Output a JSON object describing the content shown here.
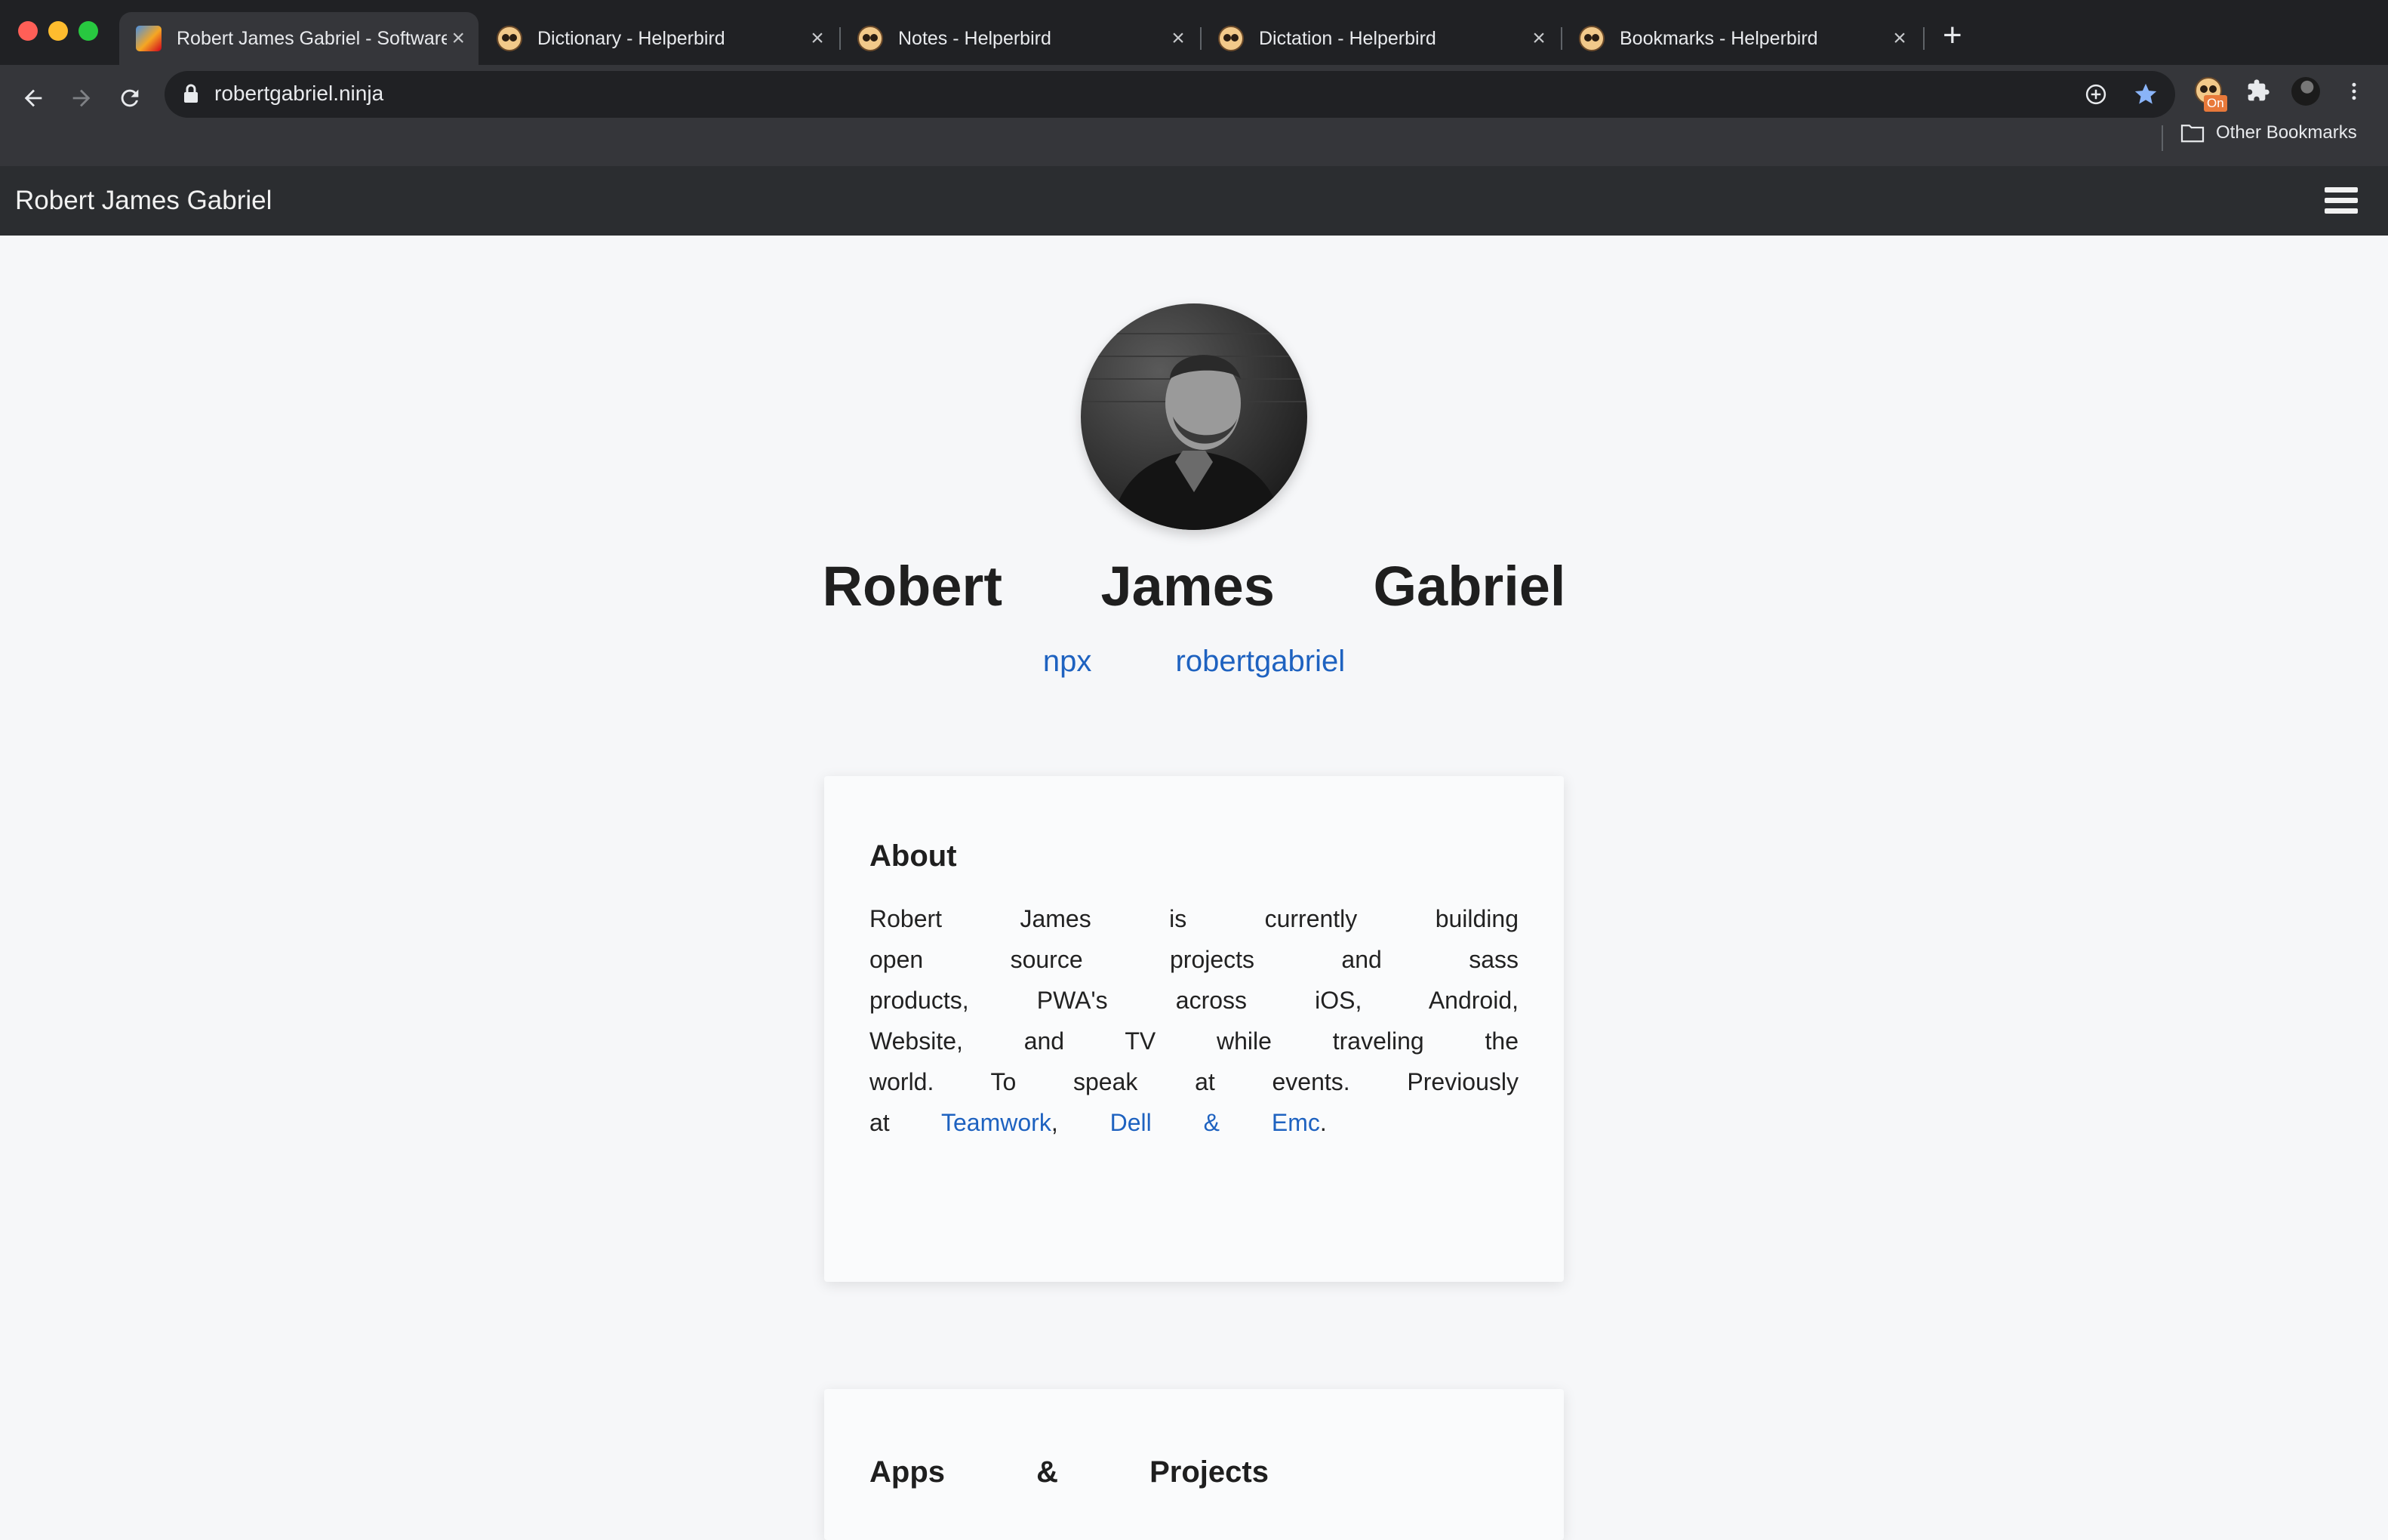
{
  "browser": {
    "tabs": [
      {
        "title": "Robert James Gabriel - Software",
        "active": true
      },
      {
        "title": "Dictionary - Helperbird",
        "active": false
      },
      {
        "title": "Notes - Helperbird",
        "active": false
      },
      {
        "title": "Dictation - Helperbird",
        "active": false
      },
      {
        "title": "Bookmarks - Helperbird",
        "active": false
      }
    ],
    "url": "robertgabriel.ninja",
    "extension_badge": "On",
    "other_bookmarks": "Other Bookmarks"
  },
  "site": {
    "brand": "Robert James Gabriel",
    "name": "Robert James Gabriel",
    "npx_command": "npx robertgabriel",
    "about": {
      "heading": "About",
      "text": "Robert James is currently building open source projects and sass products, PWA's across iOS, Android, Website, and TV while traveling the world. To speak at events. Previously at",
      "link_teamwork": "Teamwork",
      "link_dell": "Dell & Emc",
      "comma": ",",
      "period": "."
    },
    "apps_heading": "Apps & Projects"
  },
  "colors": {
    "chrome_dark": "#202124",
    "chrome_toolbar": "#35363a",
    "site_header": "#2b2d30",
    "link": "#1e62c0",
    "star": "#8ab4f8"
  }
}
